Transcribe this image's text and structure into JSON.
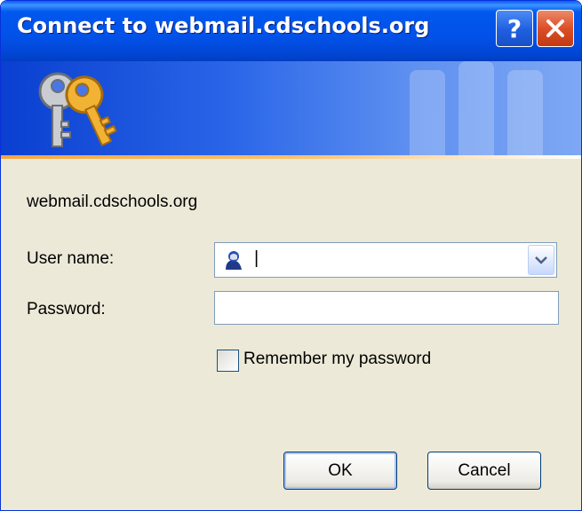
{
  "window": {
    "title": "Connect to webmail.cdschools.org",
    "help_label": "?",
    "close_label": "✕"
  },
  "dialog": {
    "server": "webmail.cdschools.org",
    "user_label": "User name:",
    "user_value": "|",
    "password_label": "Password:",
    "password_value": "",
    "remember_label": "Remember my password",
    "remember_checked": false
  },
  "buttons": {
    "ok": "OK",
    "cancel": "Cancel"
  },
  "icons": {
    "banner": "keys-icon",
    "user": "user-avatar-icon",
    "dropdown": "chevron-down-icon"
  },
  "colors": {
    "titlebar": "#0251e8",
    "close": "#dc4f27",
    "dialog_bg": "#ece9d8"
  }
}
